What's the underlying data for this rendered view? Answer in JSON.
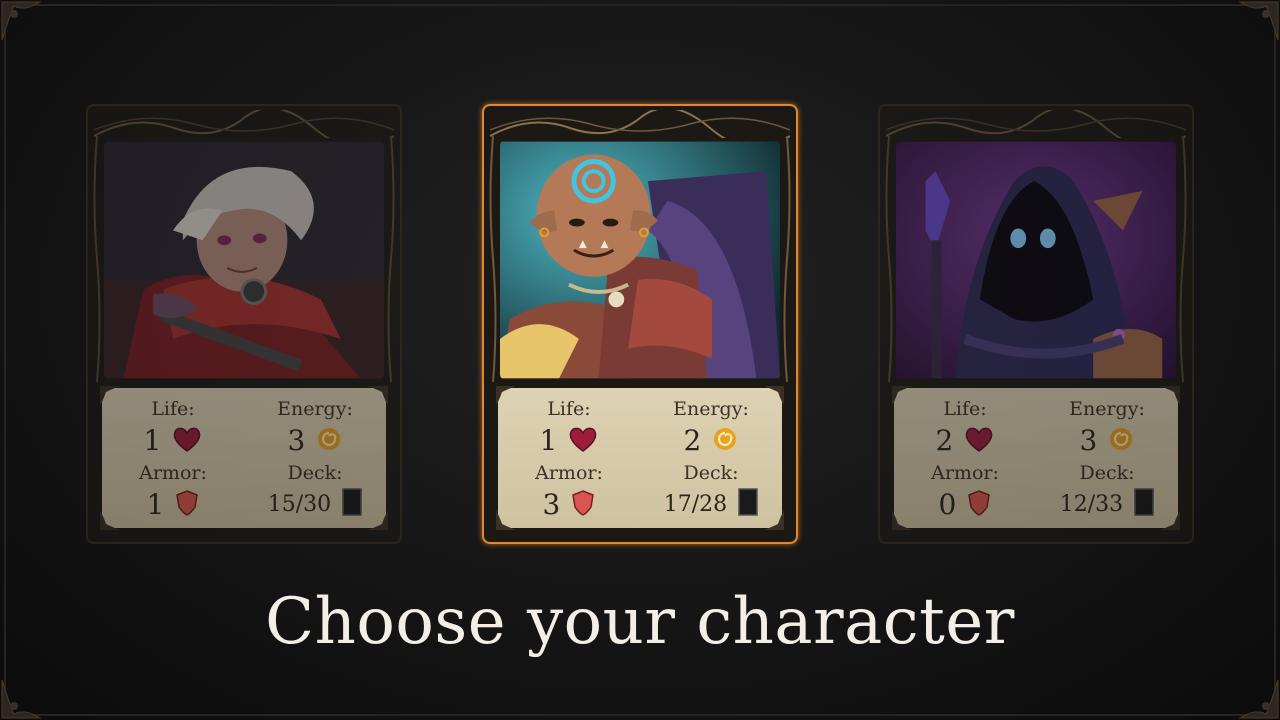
{
  "title": "Choose your character",
  "labels": {
    "life": "Life:",
    "energy": "Energy:",
    "armor": "Armor:",
    "deck": "Deck:"
  },
  "characters": [
    {
      "name": "rogue",
      "life": "1",
      "energy": "3",
      "armor": "1",
      "deck": "15/30",
      "selected": false
    },
    {
      "name": "orc",
      "life": "1",
      "energy": "2",
      "armor": "3",
      "deck": "17/28",
      "selected": true
    },
    {
      "name": "mage",
      "life": "2",
      "energy": "3",
      "armor": "0",
      "deck": "12/33",
      "selected": false
    }
  ],
  "icons": {
    "life": "heart-icon",
    "energy": "energy-swirl-icon",
    "armor": "shield-icon",
    "deck": "deck-card-icon"
  },
  "colors": {
    "accent": "#e0892a",
    "parchment": "#d6caa9",
    "heart": "#9c1e3c",
    "shield": "#d9554f",
    "energy": "#e8a21f"
  }
}
